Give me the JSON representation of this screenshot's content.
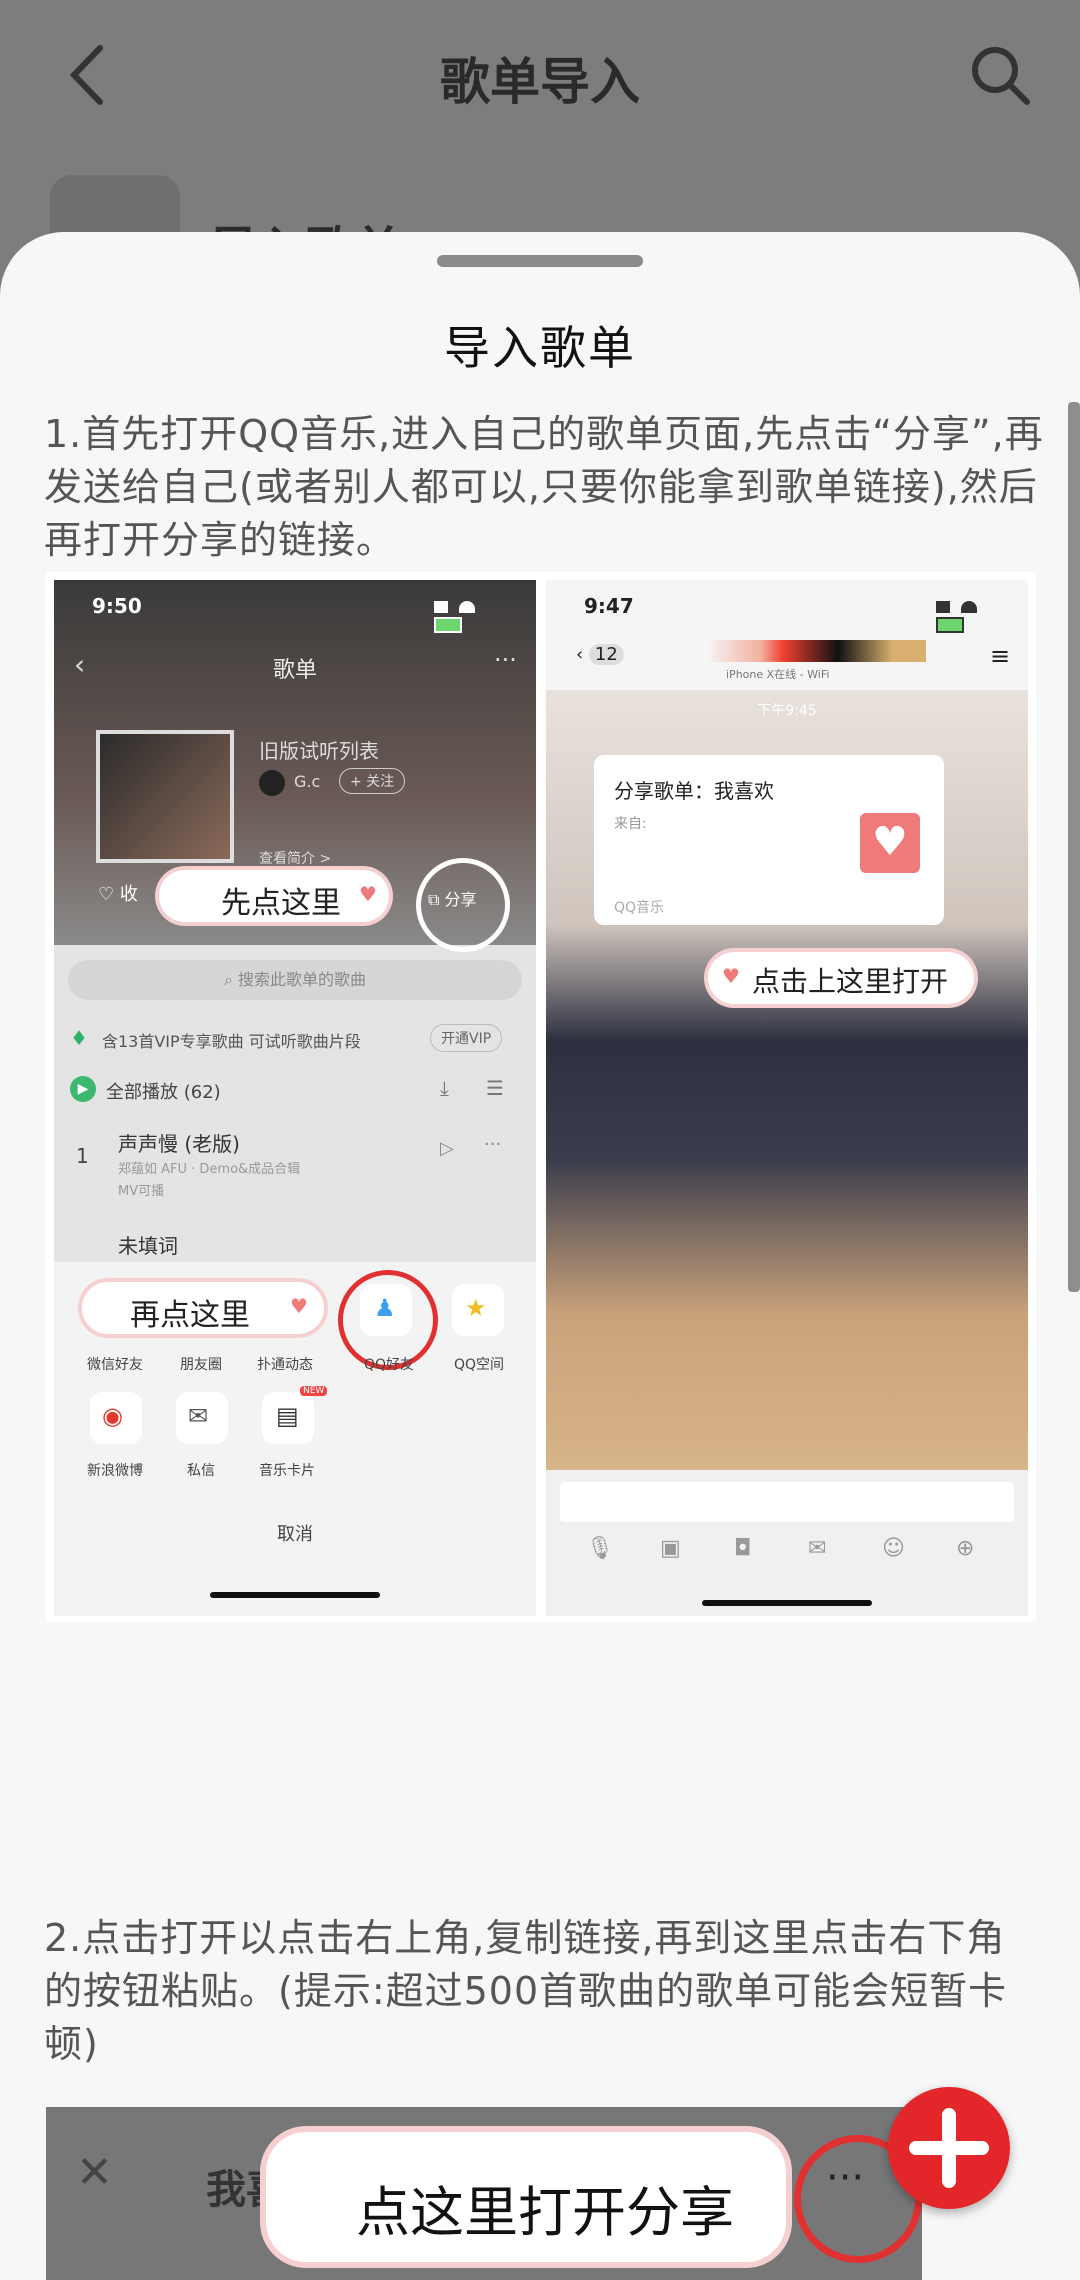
{
  "header": {
    "title": "歌单导入"
  },
  "underlay": {
    "row_label": "导入歌单"
  },
  "sheet": {
    "title": "导入歌单",
    "step1": "1.首先打开QQ音乐,进入自己的歌单页面,先点击“分享”,再发送给自己(或者别人都可以,只要你能拿到歌单链接),然后再打开分享的链接。",
    "step2": "2.点击打开以点击右上角,复制链接,再到这里点击右下角的按钮粘贴。(提示:超过500首歌曲的歌单可能会短暂卡顿)"
  },
  "tutorial_left": {
    "time": "9:50",
    "nav_title": "歌单",
    "playlist_name": "旧版试听列表",
    "user": "G.c",
    "follow": "+ 关注",
    "intro": "查看简介 >",
    "collect": "收",
    "callout1": "先点这里",
    "share_label": "分享",
    "search_placeholder": "搜索此歌单的歌曲",
    "vip_text": "含13首VIP专享歌曲 可试听歌曲片段",
    "vip_btn": "开通VIP",
    "play_all": "全部播放 (62)",
    "song1_num": "1",
    "song1_title": "声声慢 (老版)",
    "song1_sub": "郑蕴如 AFU · Demo&成品合辑",
    "song1_mv": "MV可播",
    "song2_title": "未填词",
    "callout2": "再点这里",
    "share_targets": [
      "微信好友",
      "朋友圈",
      "扑通动态",
      "QQ好友",
      "QQ空间"
    ],
    "share_targets2": [
      "新浪微博",
      "私信",
      "音乐卡片"
    ],
    "new_badge": "NEW",
    "cancel": "取消"
  },
  "tutorial_right": {
    "time": "9:47",
    "back_count": "12",
    "chat_sub": "iPhone X在线 - WiFi",
    "msg_time": "下午9:45",
    "card_title": "分享歌单：我喜欢",
    "card_from": "来自:",
    "card_footer": "QQ音乐",
    "callout": "点击上这里打开"
  },
  "fragment": {
    "callout": "点这里打开分享",
    "label": "我喜"
  }
}
